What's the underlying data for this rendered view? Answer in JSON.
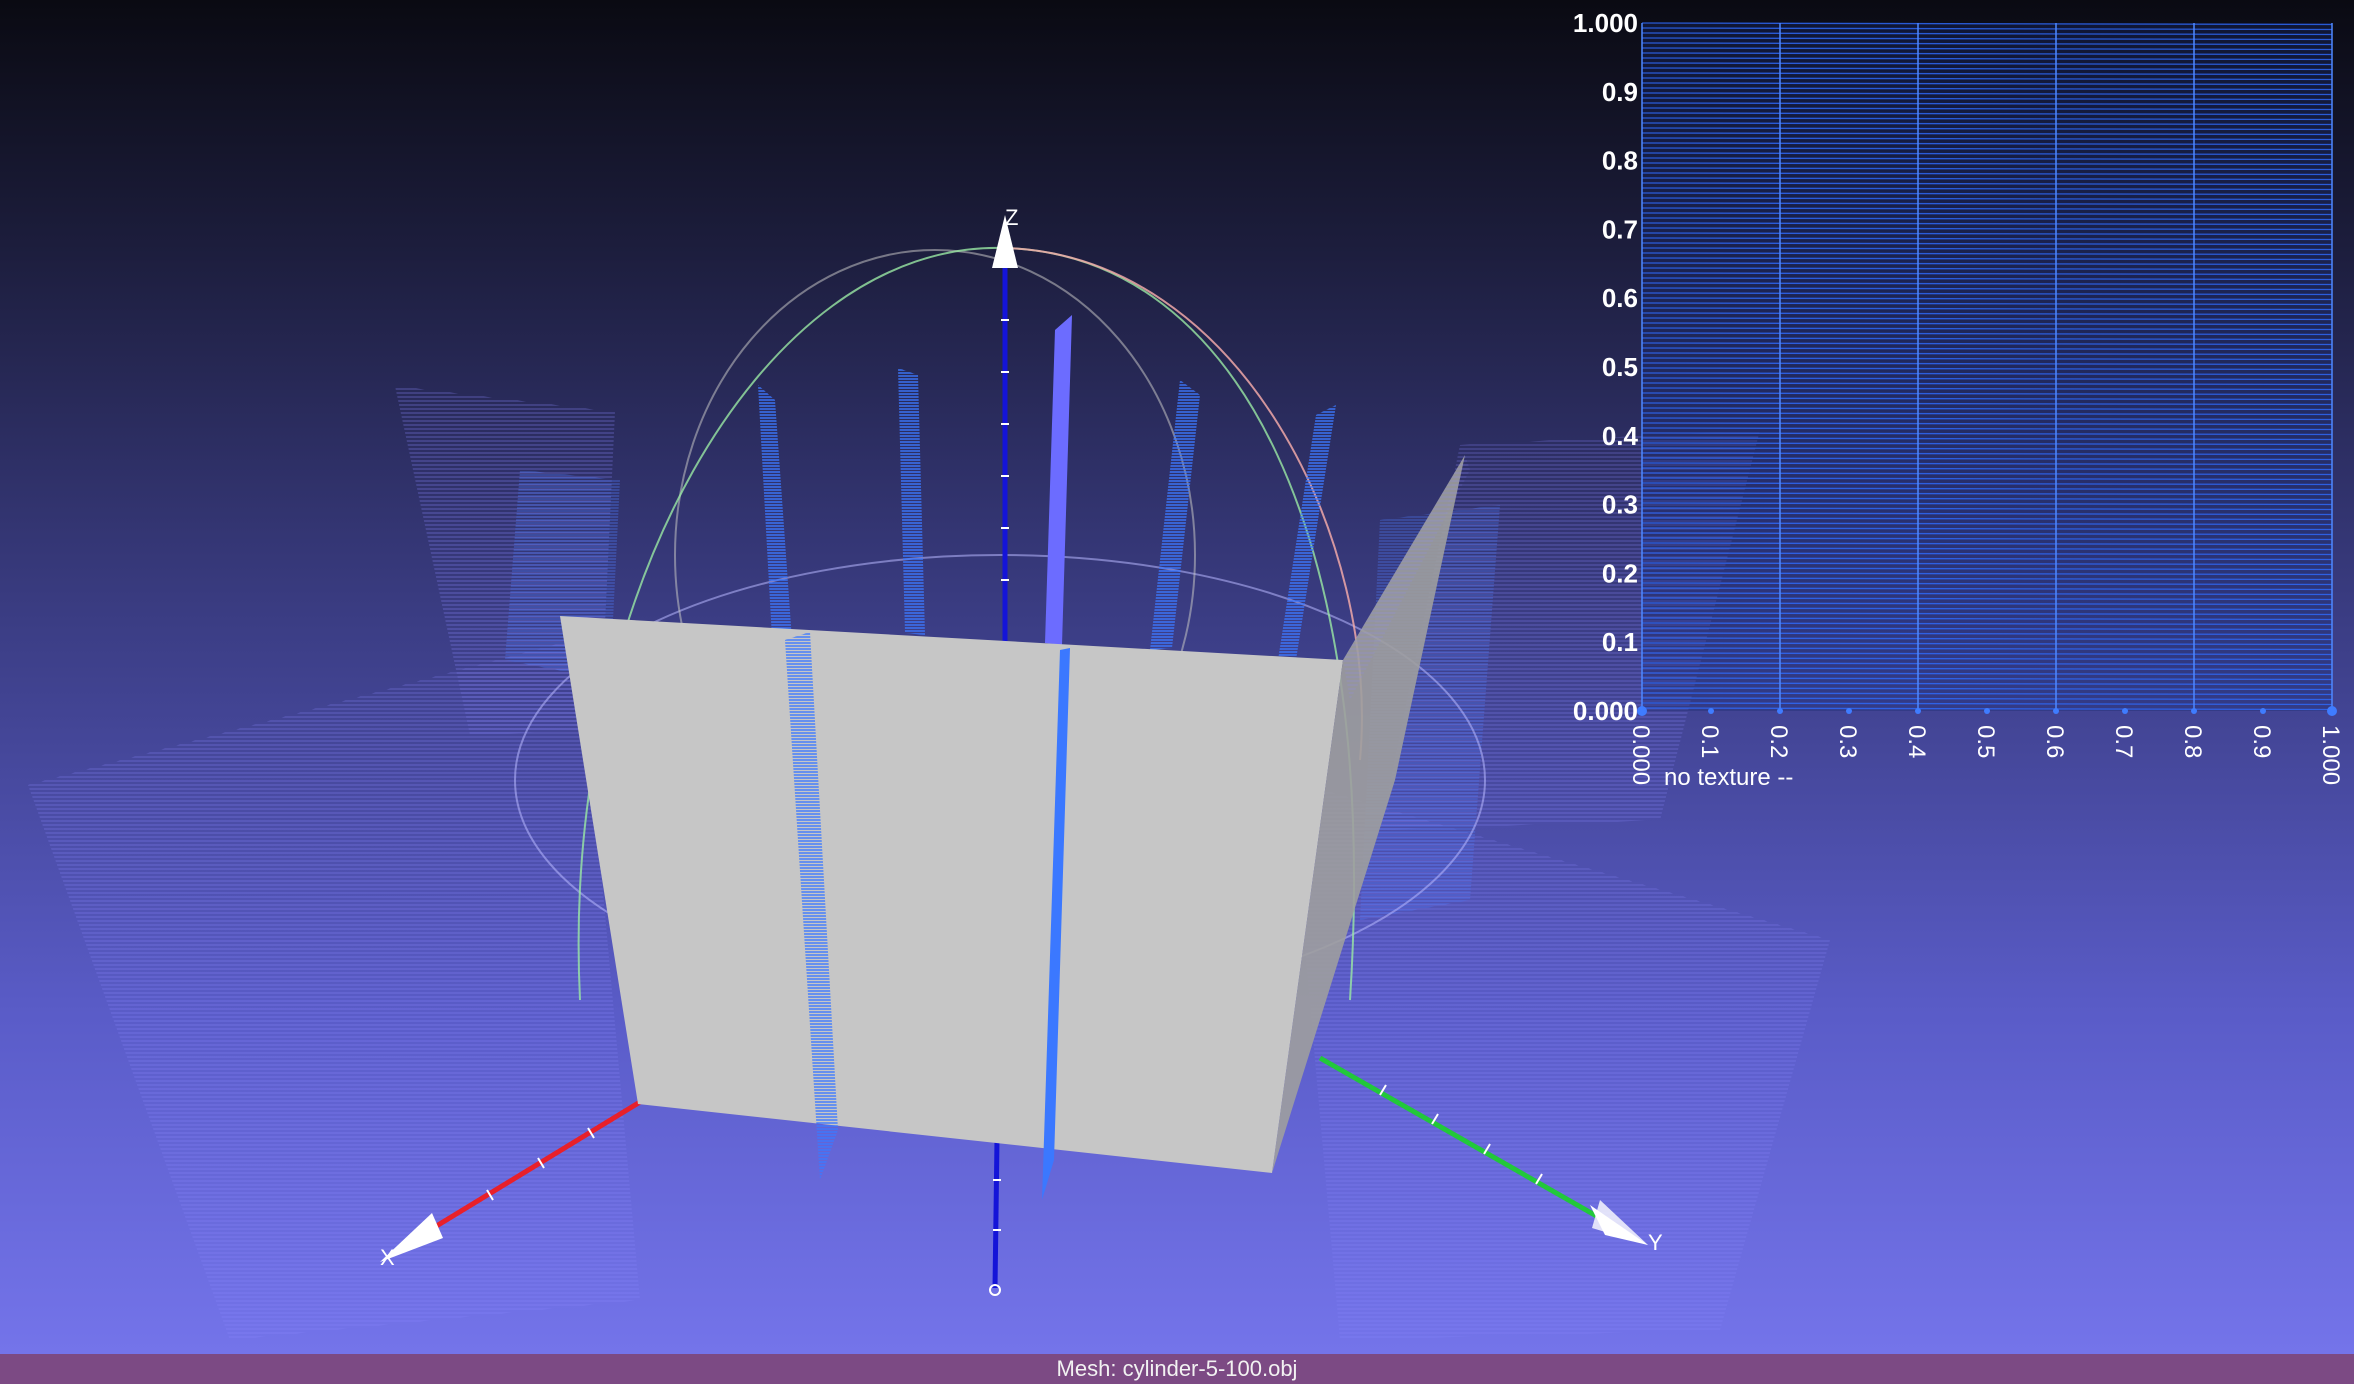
{
  "viewport": {
    "axes": {
      "x_label": "X",
      "y_label": "Y",
      "z_label": "Z"
    }
  },
  "uv_panel": {
    "y_ticks": [
      "1.000",
      "0.9",
      "0.8",
      "0.7",
      "0.6",
      "0.5",
      "0.4",
      "0.3",
      "0.2",
      "0.1",
      "0.000"
    ],
    "x_ticks": [
      "0.000",
      "0.1",
      "0.2",
      "0.3",
      "0.4",
      "0.5",
      "0.6",
      "0.7",
      "0.8",
      "0.9",
      "1.000"
    ],
    "texture_note": "no texture --"
  },
  "status_bar": {
    "text": "Mesh: cylinder-5-100.obj"
  },
  "colors": {
    "x_axis": "#e8202a",
    "y_axis": "#22c83a",
    "z_axis": "#1414d8",
    "mesh_face": "#c6c6c6",
    "uv_lines": "#2f6bff",
    "status_bar": "#7c4a84"
  }
}
